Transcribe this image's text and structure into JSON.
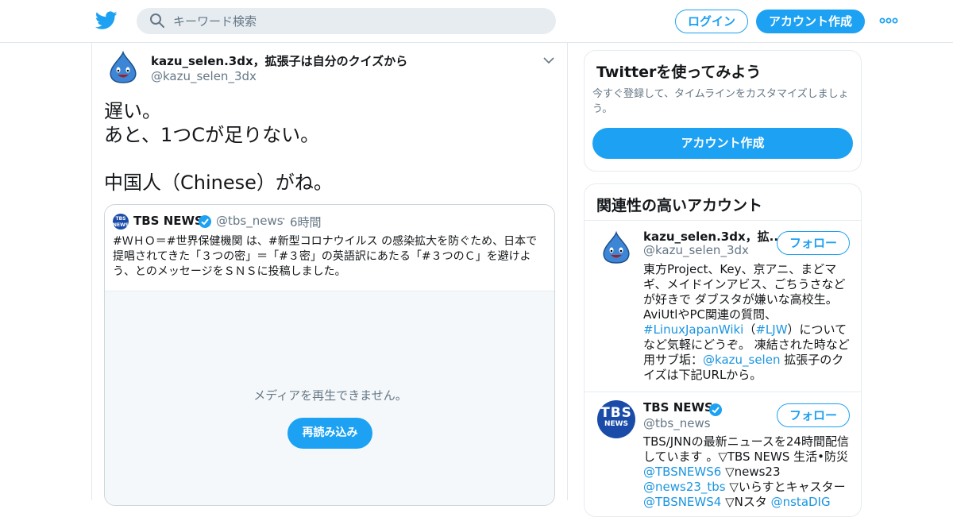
{
  "header": {
    "search_placeholder": "キーワード検索",
    "login_label": "ログイン",
    "signup_label": "アカウント作成"
  },
  "tweet": {
    "author_name": "kazu_selen.3dx，拡張子は自分のクイズから",
    "author_handle": "@kazu_selen_3dx",
    "text_lines": [
      "遅い。",
      "あと、1つCが足りない。",
      "",
      "中国人（Chinese）がね。"
    ]
  },
  "quote": {
    "logo_text": "TBS NEWS",
    "name": "TBS NEWS",
    "handle": "@tbs_news",
    "dot": "·",
    "time": "6時間",
    "text": "#ＷＨＯ＝#世界保健機関 は、#新型コロナウイルス の感染拡大を防ぐため、日本で提唱されてきた「３つの密」＝「#３密」の英語訳にあたる「#３つのＣ」を避けよう、とのメッセージをＳＮＳに投稿しました。",
    "media_message": "メディアを再生できません。",
    "reload_label": "再読み込み"
  },
  "sidebar": {
    "signup_card": {
      "title": "Twitterを使ってみよう",
      "subtitle": "今すぐ登録して、タイムラインをカスタマイズしましょう。",
      "button_label": "アカウント作成"
    },
    "related": {
      "title": "関連性の高いアカウント",
      "follow_label": "フォロー",
      "accounts": [
        {
          "name": "kazu_selen.3dx，拡...",
          "handle": "@kazu_selen_3dx",
          "bio": [
            {
              "t": "東方Project、Key、京アニ、まどマギ、メイドインアビス、ごちうさなどが好きで ダブスタが嫌いな高校生。AviUtlやPC関連の質問、"
            },
            {
              "t": "#LinuxJapanWiki",
              "link": true
            },
            {
              "t": "（"
            },
            {
              "t": "#LJW",
              "link": true
            },
            {
              "t": "）についてなど気軽にどうぞ。 凍結された時など用サブ垢："
            },
            {
              "t": "@kazu_selen",
              "link": true
            },
            {
              "t": " 拡張子のクイズは下記URLから。"
            }
          ]
        },
        {
          "name": "TBS NEWS",
          "handle": "@tbs_news",
          "avatar_line1": "TBS",
          "avatar_line2": "NEWS",
          "bio": [
            {
              "t": "TBS/JNNの最新ニュースを24時間配信しています 。▽TBS NEWS 生活•防災 "
            },
            {
              "t": "@TBSNEWS6",
              "link": true
            },
            {
              "t": " ▽news23 "
            },
            {
              "t": "@news23_tbs",
              "link": true
            },
            {
              "t": " ▽いらすとキャスター "
            },
            {
              "t": "@TBSNEWS4",
              "link": true
            },
            {
              "t": " ▽Nスタ "
            },
            {
              "t": "@nstaDIG",
              "link": true
            }
          ]
        }
      ]
    }
  },
  "colors": {
    "accent": "#1da1f2",
    "link": "#1b95e0",
    "muted": "#657786",
    "tbs_blue": "#1a4ba8"
  }
}
